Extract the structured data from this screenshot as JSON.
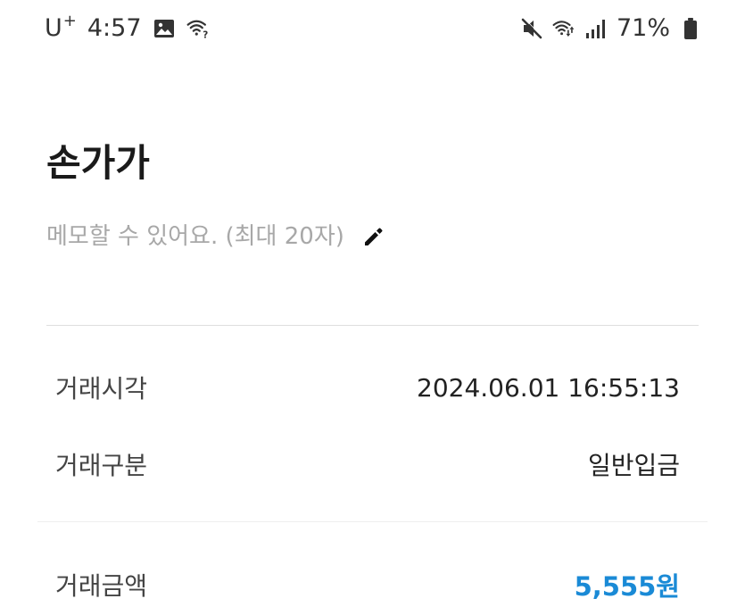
{
  "status_bar": {
    "carrier": "U",
    "carrier_sup": "+",
    "time": "4:57",
    "battery_percent": "71%",
    "icons_left": [
      "image-icon",
      "wifi-question-icon"
    ],
    "icons_right": [
      "mute-icon",
      "wifi-icon",
      "signal-icon",
      "battery-icon"
    ]
  },
  "header": {
    "title": "손가가"
  },
  "memo": {
    "placeholder": "메모할 수 있어요. (최대 20자)",
    "edit_icon": "pencil-icon"
  },
  "details": {
    "time_label": "거래시각",
    "time_value": "2024.06.01 16:55:13",
    "type_label": "거래구분",
    "type_value": "일반입금",
    "amount_label": "거래금액",
    "amount_value": "5,555원"
  },
  "colors": {
    "accent": "#1a8ad6",
    "memo_text": "#a8a8a8",
    "divider": "#dedede"
  }
}
